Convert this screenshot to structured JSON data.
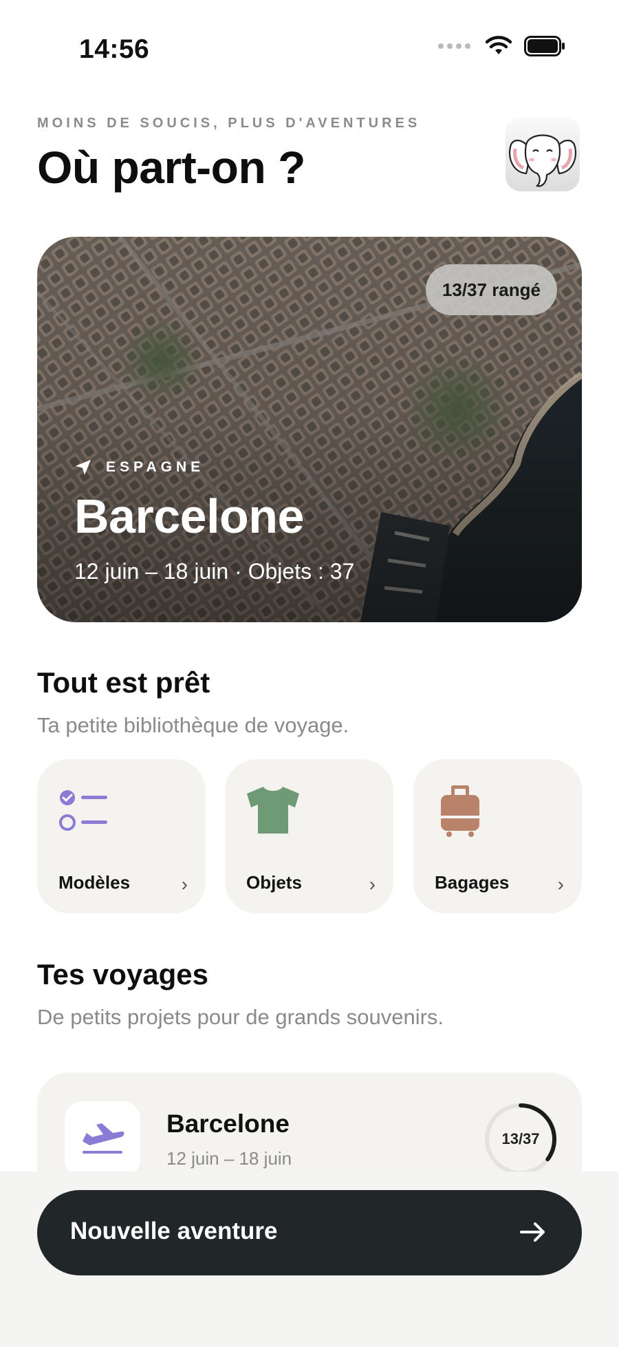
{
  "status_bar": {
    "time": "14:56"
  },
  "header": {
    "eyebrow": "MOINS DE SOUCIS, PLUS D'AVENTURES",
    "title": "Où part-on ?"
  },
  "featured_trip": {
    "badge": "13/37 rangé",
    "country": "ESPAGNE",
    "city": "Barcelone",
    "meta": "12 juin – 18 juin · Objets : 37"
  },
  "library": {
    "title": "Tout est prêt",
    "subtitle": "Ta petite bibliothèque de voyage.",
    "tiles": [
      {
        "label": "Modèles",
        "icon": "checklist-icon",
        "color": "#8b7ad6"
      },
      {
        "label": "Objets",
        "icon": "tshirt-icon",
        "color": "#6f9a76"
      },
      {
        "label": "Bagages",
        "icon": "suitcase-icon",
        "color": "#b9826a"
      }
    ]
  },
  "trips": {
    "title": "Tes voyages",
    "subtitle": "De petits projets pour de grands souvenirs.",
    "items": [
      {
        "name": "Barcelone",
        "dates": "12 juin – 18 juin",
        "progress_label": "13/37",
        "packed": 13,
        "total": 37,
        "icon": "airplane-icon"
      }
    ]
  },
  "cta": {
    "label": "Nouvelle aventure"
  },
  "colors": {
    "accent_purple": "#8b7ad6",
    "cta_background": "#212729",
    "tile_background": "#f4f3f0"
  }
}
